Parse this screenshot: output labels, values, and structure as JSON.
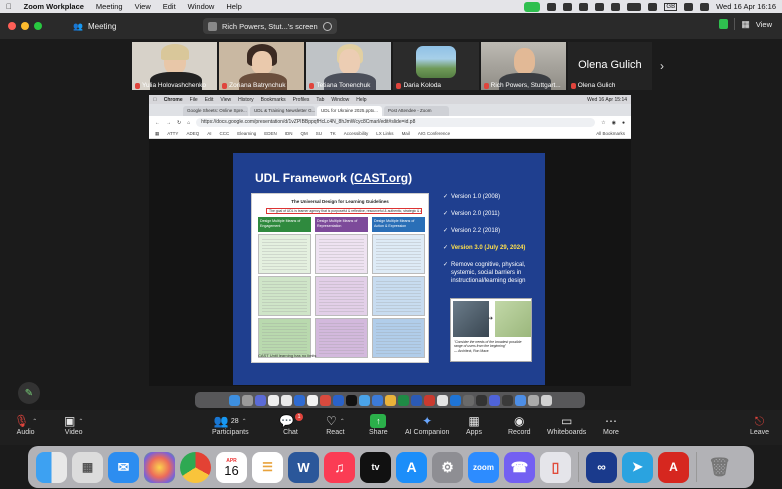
{
  "menubar": {
    "app": "Zoom Workplace",
    "items": [
      "Meeting",
      "View",
      "Edit",
      "Window",
      "Help"
    ],
    "clock": "Wed 16 Apr  16:16",
    "keyboard": "GB"
  },
  "zoom_title": {
    "meeting_label": "Meeting",
    "share_label": "Rich Powers, Stut...'s screen",
    "view_label": "View"
  },
  "participants": [
    {
      "name": "Yulia Holovashchenko"
    },
    {
      "name": "Zoriana Batrynchuk"
    },
    {
      "name": "Tetiana Tonenchuk"
    },
    {
      "name": "Daria Koloda"
    },
    {
      "name": "Rich Powers, Stuttgart..."
    },
    {
      "name": "Olena Gulich",
      "big_name": "Olena Gulich"
    }
  ],
  "shared": {
    "menubar": [
      "Chrome",
      "File",
      "Edit",
      "View",
      "History",
      "Bookmarks",
      "Profiles",
      "Tab",
      "Window",
      "Help"
    ],
    "clock": "Wed 16 Apr  15:14",
    "tabs": [
      "Google Sheets: Online Spre...",
      "UDL & Training Newsletter G...",
      "UDL for Ukraine 2025.pptx...",
      "Post Attendee - Zoom"
    ],
    "url": "https://docs.google.com/presentation/d/1vZPIBBppqfHcLc4N_8hJmWcyc8Cmarl/edit#slide=id.p8",
    "bookmarks": [
      "ATTY",
      "ADEQ",
      "AI",
      "CCC",
      "Elearning",
      "EDEN",
      "IDN",
      "QM",
      "SU",
      "TK",
      "Accessibility",
      "LX Links",
      "Mail",
      "AIG Conference"
    ],
    "all_bookmarks": "All Bookmarks"
  },
  "slide": {
    "title_prefix": "UDL Framework (",
    "title_link": "CAST.org",
    "title_suffix": ")",
    "card_title": "The Universal Design for Learning Guidelines",
    "card_goal": "The goal of UDL is learner agency that is purposeful & reflective, resourceful & authentic, strategic & action-oriented",
    "columns": [
      "Design Multiple Means of Engagement",
      "Design Multiple Means of Representation",
      "Design Multiple Means of Action & Expression"
    ],
    "card_footer": "CAST  Until learning has no limits",
    "versions": [
      {
        "text": "Version 1.0 (2008)",
        "highlight": false
      },
      {
        "text": "Version 2.0 (2011)",
        "highlight": false
      },
      {
        "text": "Version 2.2 (2018)",
        "highlight": false
      },
      {
        "text": "Version 3.0 (July 29, 2024)",
        "highlight": true
      },
      {
        "text": "Remove cognitive, physical, systemic, social barriers in instructional/learning design",
        "highlight": false
      }
    ],
    "quote": "\"Consider the needs of the broadest possible range of users from the beginning\"",
    "quote_author": "— Architect, Ron Mace"
  },
  "toolbar": {
    "audio": "Audio",
    "video": "Video",
    "participants": "Participants",
    "participants_count": "28",
    "chat": "Chat",
    "chat_badge": "1",
    "react": "React",
    "share": "Share",
    "ai": "AI Companion",
    "apps": "Apps",
    "record": "Record",
    "whiteboards": "Whiteboards",
    "more": "More",
    "leave": "Leave"
  },
  "dock": {
    "calendar_month": "APR",
    "calendar_day": "16",
    "zoom_label": "zoom"
  }
}
